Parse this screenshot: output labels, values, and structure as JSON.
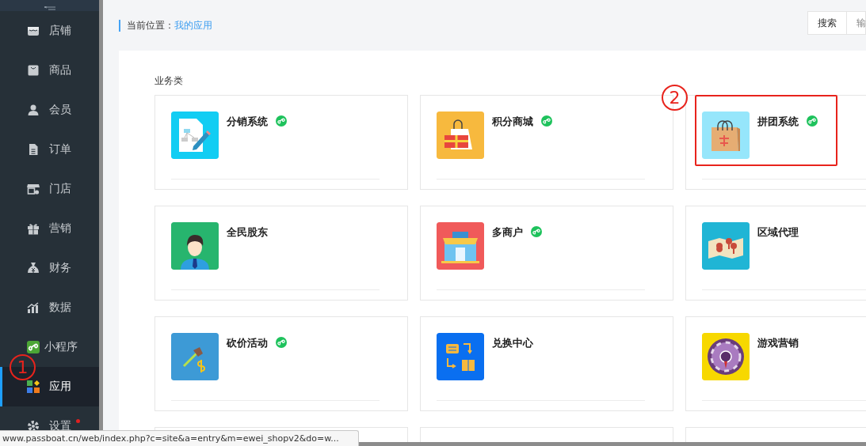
{
  "sidebar": {
    "items": [
      {
        "label": "店铺",
        "selected": false
      },
      {
        "label": "商品",
        "selected": false
      },
      {
        "label": "会员",
        "selected": false
      },
      {
        "label": "订单",
        "selected": false
      },
      {
        "label": "门店",
        "selected": false
      },
      {
        "label": "营销",
        "selected": false
      },
      {
        "label": "财务",
        "selected": false
      },
      {
        "label": "数据",
        "selected": false
      },
      {
        "label": "小程序",
        "selected": false
      },
      {
        "label": "应用",
        "selected": true,
        "callout": "1"
      },
      {
        "label": "设置",
        "selected": false,
        "dot": true
      }
    ]
  },
  "breadcrumb": {
    "prefix": "当前位置：",
    "current": "我的应用"
  },
  "toolbar": {
    "buttons": [
      "搜索",
      "输"
    ]
  },
  "section": {
    "title": "业务类"
  },
  "cards": [
    {
      "kind": "app",
      "title": "分销系统",
      "mini_program": true
    },
    {
      "kind": "app",
      "title": "积分商城",
      "mini_program": true
    },
    {
      "kind": "app",
      "title": "拼团系统",
      "mini_program": true,
      "callout": "2",
      "highlighted": true
    },
    {
      "kind": "app",
      "title": "全民股东",
      "mini_program": false
    },
    {
      "kind": "app",
      "title": "多商户",
      "mini_program": true
    },
    {
      "kind": "app",
      "title": "区域代理",
      "mini_program": false
    },
    {
      "kind": "app",
      "title": "砍价活动",
      "mini_program": true
    },
    {
      "kind": "app",
      "title": "兑换中心",
      "mini_program": false
    },
    {
      "kind": "app",
      "title": "游戏营销",
      "mini_program": false
    },
    {
      "kind": "empty"
    },
    {
      "kind": "empty"
    },
    {
      "kind": "empty"
    }
  ],
  "status_bar": {
    "url": "www.passboat.cn/web/index.php?c=site&a=entry&m=ewei_shopv2&do=w..."
  }
}
